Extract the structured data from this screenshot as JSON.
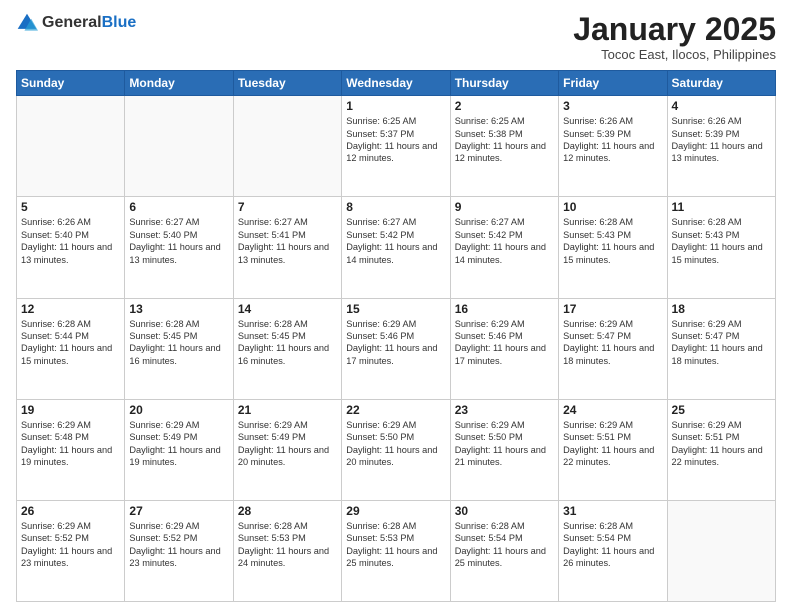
{
  "logo": {
    "general": "General",
    "blue": "Blue"
  },
  "header": {
    "month_title": "January 2025",
    "location": "Tococ East, Ilocos, Philippines"
  },
  "days_of_week": [
    "Sunday",
    "Monday",
    "Tuesday",
    "Wednesday",
    "Thursday",
    "Friday",
    "Saturday"
  ],
  "weeks": [
    [
      {
        "day": "",
        "content": ""
      },
      {
        "day": "",
        "content": ""
      },
      {
        "day": "",
        "content": ""
      },
      {
        "day": "1",
        "content": "Sunrise: 6:25 AM\nSunset: 5:37 PM\nDaylight: 11 hours and 12 minutes."
      },
      {
        "day": "2",
        "content": "Sunrise: 6:25 AM\nSunset: 5:38 PM\nDaylight: 11 hours and 12 minutes."
      },
      {
        "day": "3",
        "content": "Sunrise: 6:26 AM\nSunset: 5:39 PM\nDaylight: 11 hours and 12 minutes."
      },
      {
        "day": "4",
        "content": "Sunrise: 6:26 AM\nSunset: 5:39 PM\nDaylight: 11 hours and 13 minutes."
      }
    ],
    [
      {
        "day": "5",
        "content": "Sunrise: 6:26 AM\nSunset: 5:40 PM\nDaylight: 11 hours and 13 minutes."
      },
      {
        "day": "6",
        "content": "Sunrise: 6:27 AM\nSunset: 5:40 PM\nDaylight: 11 hours and 13 minutes."
      },
      {
        "day": "7",
        "content": "Sunrise: 6:27 AM\nSunset: 5:41 PM\nDaylight: 11 hours and 13 minutes."
      },
      {
        "day": "8",
        "content": "Sunrise: 6:27 AM\nSunset: 5:42 PM\nDaylight: 11 hours and 14 minutes."
      },
      {
        "day": "9",
        "content": "Sunrise: 6:27 AM\nSunset: 5:42 PM\nDaylight: 11 hours and 14 minutes."
      },
      {
        "day": "10",
        "content": "Sunrise: 6:28 AM\nSunset: 5:43 PM\nDaylight: 11 hours and 15 minutes."
      },
      {
        "day": "11",
        "content": "Sunrise: 6:28 AM\nSunset: 5:43 PM\nDaylight: 11 hours and 15 minutes."
      }
    ],
    [
      {
        "day": "12",
        "content": "Sunrise: 6:28 AM\nSunset: 5:44 PM\nDaylight: 11 hours and 15 minutes."
      },
      {
        "day": "13",
        "content": "Sunrise: 6:28 AM\nSunset: 5:45 PM\nDaylight: 11 hours and 16 minutes."
      },
      {
        "day": "14",
        "content": "Sunrise: 6:28 AM\nSunset: 5:45 PM\nDaylight: 11 hours and 16 minutes."
      },
      {
        "day": "15",
        "content": "Sunrise: 6:29 AM\nSunset: 5:46 PM\nDaylight: 11 hours and 17 minutes."
      },
      {
        "day": "16",
        "content": "Sunrise: 6:29 AM\nSunset: 5:46 PM\nDaylight: 11 hours and 17 minutes."
      },
      {
        "day": "17",
        "content": "Sunrise: 6:29 AM\nSunset: 5:47 PM\nDaylight: 11 hours and 18 minutes."
      },
      {
        "day": "18",
        "content": "Sunrise: 6:29 AM\nSunset: 5:47 PM\nDaylight: 11 hours and 18 minutes."
      }
    ],
    [
      {
        "day": "19",
        "content": "Sunrise: 6:29 AM\nSunset: 5:48 PM\nDaylight: 11 hours and 19 minutes."
      },
      {
        "day": "20",
        "content": "Sunrise: 6:29 AM\nSunset: 5:49 PM\nDaylight: 11 hours and 19 minutes."
      },
      {
        "day": "21",
        "content": "Sunrise: 6:29 AM\nSunset: 5:49 PM\nDaylight: 11 hours and 20 minutes."
      },
      {
        "day": "22",
        "content": "Sunrise: 6:29 AM\nSunset: 5:50 PM\nDaylight: 11 hours and 20 minutes."
      },
      {
        "day": "23",
        "content": "Sunrise: 6:29 AM\nSunset: 5:50 PM\nDaylight: 11 hours and 21 minutes."
      },
      {
        "day": "24",
        "content": "Sunrise: 6:29 AM\nSunset: 5:51 PM\nDaylight: 11 hours and 22 minutes."
      },
      {
        "day": "25",
        "content": "Sunrise: 6:29 AM\nSunset: 5:51 PM\nDaylight: 11 hours and 22 minutes."
      }
    ],
    [
      {
        "day": "26",
        "content": "Sunrise: 6:29 AM\nSunset: 5:52 PM\nDaylight: 11 hours and 23 minutes."
      },
      {
        "day": "27",
        "content": "Sunrise: 6:29 AM\nSunset: 5:52 PM\nDaylight: 11 hours and 23 minutes."
      },
      {
        "day": "28",
        "content": "Sunrise: 6:28 AM\nSunset: 5:53 PM\nDaylight: 11 hours and 24 minutes."
      },
      {
        "day": "29",
        "content": "Sunrise: 6:28 AM\nSunset: 5:53 PM\nDaylight: 11 hours and 25 minutes."
      },
      {
        "day": "30",
        "content": "Sunrise: 6:28 AM\nSunset: 5:54 PM\nDaylight: 11 hours and 25 minutes."
      },
      {
        "day": "31",
        "content": "Sunrise: 6:28 AM\nSunset: 5:54 PM\nDaylight: 11 hours and 26 minutes."
      },
      {
        "day": "",
        "content": ""
      }
    ]
  ]
}
